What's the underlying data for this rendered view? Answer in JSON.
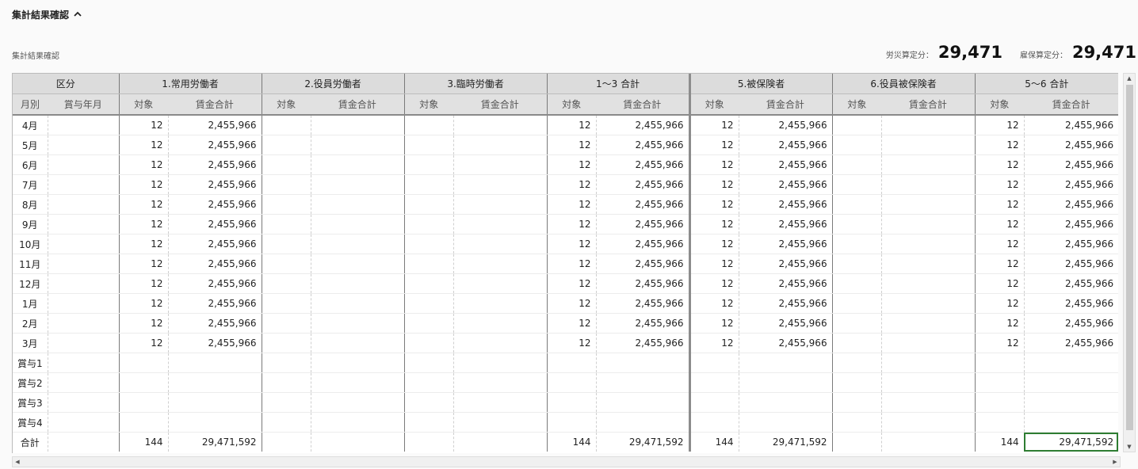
{
  "section": {
    "title": "集計結果確認",
    "sub_label": "集計結果確認"
  },
  "summary": {
    "rousai_label": "労災算定分：",
    "rousai_value": "29,471",
    "koyou_label": "雇保算定分：",
    "koyou_value": "29,471"
  },
  "table": {
    "group_headers": [
      "区分",
      "1.常用労働者",
      "2.役員労働者",
      "3.臨時労働者",
      "1～3 合計",
      "5.被保険者",
      "6.役員被保険者",
      "5～6 合計"
    ],
    "sub_headers": [
      "月別",
      "賞与年月",
      "対象",
      "賃金合計",
      "対象",
      "賃金合計",
      "対象",
      "賃金合計",
      "対象",
      "賃金合計",
      "対象",
      "賃金合計",
      "対象",
      "賃金合計",
      "対象",
      "賃金合計"
    ],
    "rows": [
      [
        "4月",
        "",
        "12",
        "2,455,966",
        "",
        "",
        "",
        "",
        "12",
        "2,455,966",
        "12",
        "2,455,966",
        "",
        "",
        "12",
        "2,455,966"
      ],
      [
        "5月",
        "",
        "12",
        "2,455,966",
        "",
        "",
        "",
        "",
        "12",
        "2,455,966",
        "12",
        "2,455,966",
        "",
        "",
        "12",
        "2,455,966"
      ],
      [
        "6月",
        "",
        "12",
        "2,455,966",
        "",
        "",
        "",
        "",
        "12",
        "2,455,966",
        "12",
        "2,455,966",
        "",
        "",
        "12",
        "2,455,966"
      ],
      [
        "7月",
        "",
        "12",
        "2,455,966",
        "",
        "",
        "",
        "",
        "12",
        "2,455,966",
        "12",
        "2,455,966",
        "",
        "",
        "12",
        "2,455,966"
      ],
      [
        "8月",
        "",
        "12",
        "2,455,966",
        "",
        "",
        "",
        "",
        "12",
        "2,455,966",
        "12",
        "2,455,966",
        "",
        "",
        "12",
        "2,455,966"
      ],
      [
        "9月",
        "",
        "12",
        "2,455,966",
        "",
        "",
        "",
        "",
        "12",
        "2,455,966",
        "12",
        "2,455,966",
        "",
        "",
        "12",
        "2,455,966"
      ],
      [
        "10月",
        "",
        "12",
        "2,455,966",
        "",
        "",
        "",
        "",
        "12",
        "2,455,966",
        "12",
        "2,455,966",
        "",
        "",
        "12",
        "2,455,966"
      ],
      [
        "11月",
        "",
        "12",
        "2,455,966",
        "",
        "",
        "",
        "",
        "12",
        "2,455,966",
        "12",
        "2,455,966",
        "",
        "",
        "12",
        "2,455,966"
      ],
      [
        "12月",
        "",
        "12",
        "2,455,966",
        "",
        "",
        "",
        "",
        "12",
        "2,455,966",
        "12",
        "2,455,966",
        "",
        "",
        "12",
        "2,455,966"
      ],
      [
        "1月",
        "",
        "12",
        "2,455,966",
        "",
        "",
        "",
        "",
        "12",
        "2,455,966",
        "12",
        "2,455,966",
        "",
        "",
        "12",
        "2,455,966"
      ],
      [
        "2月",
        "",
        "12",
        "2,455,966",
        "",
        "",
        "",
        "",
        "12",
        "2,455,966",
        "12",
        "2,455,966",
        "",
        "",
        "12",
        "2,455,966"
      ],
      [
        "3月",
        "",
        "12",
        "2,455,966",
        "",
        "",
        "",
        "",
        "12",
        "2,455,966",
        "12",
        "2,455,966",
        "",
        "",
        "12",
        "2,455,966"
      ],
      [
        "賞与1",
        "",
        "",
        "",
        "",
        "",
        "",
        "",
        "",
        "",
        "",
        "",
        "",
        "",
        "",
        ""
      ],
      [
        "賞与2",
        "",
        "",
        "",
        "",
        "",
        "",
        "",
        "",
        "",
        "",
        "",
        "",
        "",
        "",
        ""
      ],
      [
        "賞与3",
        "",
        "",
        "",
        "",
        "",
        "",
        "",
        "",
        "",
        "",
        "",
        "",
        "",
        "",
        ""
      ],
      [
        "賞与4",
        "",
        "",
        "",
        "",
        "",
        "",
        "",
        "",
        "",
        "",
        "",
        "",
        "",
        "",
        ""
      ],
      [
        "合計",
        "",
        "144",
        "29,471,592",
        "",
        "",
        "",
        "",
        "144",
        "29,471,592",
        "144",
        "29,471,592",
        "",
        "",
        "144",
        "29,471,592"
      ]
    ]
  },
  "icons": {
    "collapse": "chevron-up-icon",
    "scroll_up": "arrow-up-icon",
    "scroll_down": "arrow-down-icon",
    "scroll_left": "arrow-left-icon",
    "scroll_right": "arrow-right-icon"
  },
  "colors": {
    "selection": "#2e7d32",
    "header_bg": "#dcdcdc"
  }
}
